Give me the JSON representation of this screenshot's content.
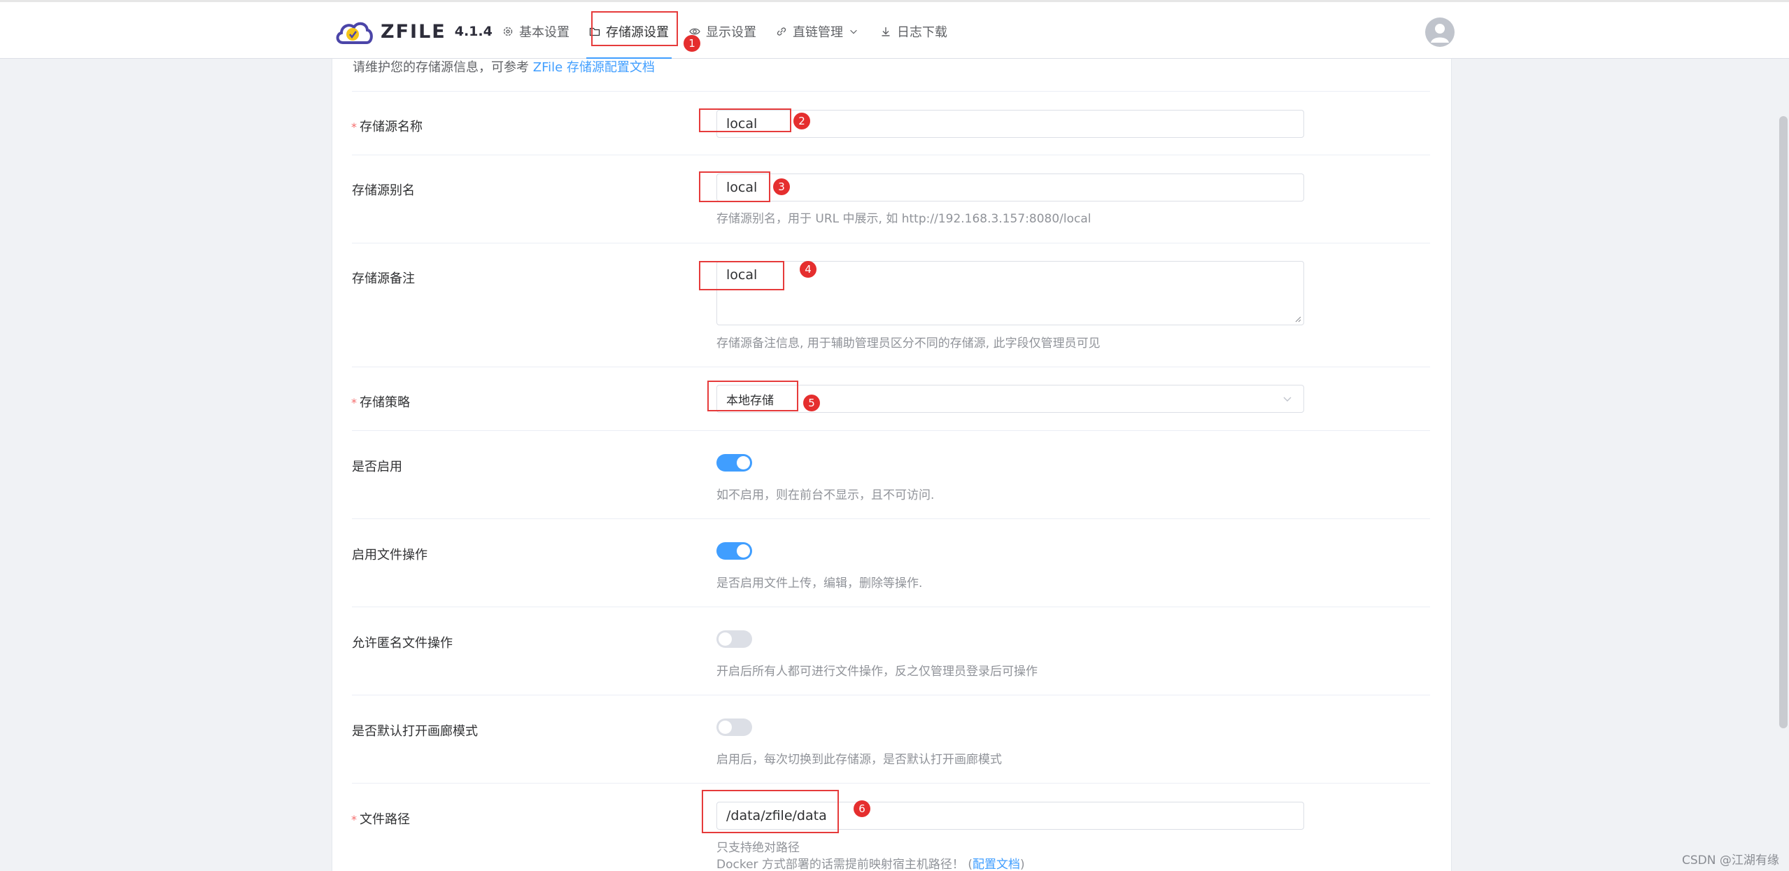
{
  "header": {
    "logo_text": "ZFILE",
    "version": "4.1.4",
    "nav": [
      {
        "label": "基本设置",
        "icon": "gear-icon"
      },
      {
        "label": "存储源设置",
        "icon": "folder-icon"
      },
      {
        "label": "显示设置",
        "icon": "eye-icon"
      },
      {
        "label": "直链管理",
        "icon": "link-icon"
      },
      {
        "label": "日志下载",
        "icon": "download-icon"
      }
    ],
    "active_nav": "存储源设置"
  },
  "intro": {
    "text": "请维护您的存储源信息，可参考 ",
    "link": "ZFile 存储源配置文档"
  },
  "form": {
    "name": {
      "label": "存储源名称",
      "value": "local"
    },
    "alias": {
      "label": "存储源别名",
      "value": "local",
      "hint": "存储源别名，用于 URL 中展示, 如 http://192.168.3.157:8080/local"
    },
    "remark": {
      "label": "存储源备注",
      "value": "local",
      "hint": "存储源备注信息, 用于辅助管理员区分不同的存储源, 此字段仅管理员可见"
    },
    "strategy": {
      "label": "存储策略",
      "value": "本地存储"
    },
    "enabled": {
      "label": "是否启用",
      "on": true,
      "hint": "如不启用，则在前台不显示，且不可访问."
    },
    "file_ops": {
      "label": "启用文件操作",
      "on": true,
      "hint": "是否启用文件上传，编辑，删除等操作."
    },
    "anon_ops": {
      "label": "允许匿名文件操作",
      "on": false,
      "hint": "开启后所有人都可进行文件操作，反之仅管理员登录后可操作"
    },
    "gallery": {
      "label": "是否默认打开画廊模式",
      "on": false,
      "hint": "启用后，每次切换到此存储源，是否默认打开画廊模式"
    },
    "path": {
      "label": "文件路径",
      "value": "/data/zfile/data",
      "hint1": "只支持绝对路径",
      "hint2": "Docker 方式部署的话需提前映射宿主机路径！",
      "hint2_link": "配置文档"
    }
  },
  "badges": [
    "1",
    "2",
    "3",
    "4",
    "5",
    "6"
  ],
  "watermark": "CSDN @江湖有缘",
  "colors": {
    "accent": "#409eff",
    "annotation": "#e63b3b",
    "required": "#f56c6c"
  }
}
